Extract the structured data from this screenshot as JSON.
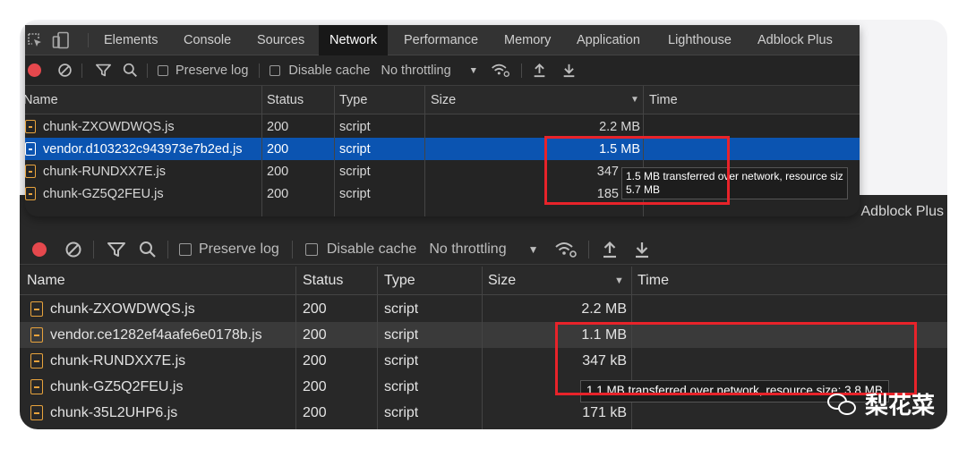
{
  "top_devtools": {
    "tabs": [
      "Elements",
      "Console",
      "Sources",
      "Network",
      "Performance",
      "Memory",
      "Application",
      "Lighthouse",
      "Adblock Plus"
    ],
    "active_tab": "Network",
    "toolbar": {
      "preserve_log": "Preserve log",
      "disable_cache": "Disable cache",
      "throttling": "No throttling"
    },
    "columns": [
      "Name",
      "Status",
      "Type",
      "Size",
      "Time"
    ],
    "rows": [
      {
        "name": "chunk-ZXOWDWQS.js",
        "status": "200",
        "type": "script",
        "size": "2.2 MB"
      },
      {
        "name": "vendor.d103232c943973e7b2ed.js",
        "status": "200",
        "type": "script",
        "size": "1.5 MB"
      },
      {
        "name": "chunk-RUNDXX7E.js",
        "status": "200",
        "type": "script",
        "size": "347"
      },
      {
        "name": "chunk-GZ5Q2FEU.js",
        "status": "200",
        "type": "script",
        "size": "185"
      }
    ],
    "tooltip_line1": "1.5 MB transferred over network, resource siz",
    "tooltip_line2": "5.7 MB"
  },
  "bottom_devtools": {
    "partial_tab": "Adblock Plus",
    "toolbar": {
      "preserve_log": "Preserve log",
      "disable_cache": "Disable cache",
      "throttling": "No throttling"
    },
    "columns": [
      "Name",
      "Status",
      "Type",
      "Size",
      "Time"
    ],
    "rows": [
      {
        "name": "chunk-ZXOWDWQS.js",
        "status": "200",
        "type": "script",
        "size": "2.2 MB"
      },
      {
        "name": "vendor.ce1282ef4aafe6e0178b.js",
        "status": "200",
        "type": "script",
        "size": "1.1 MB"
      },
      {
        "name": "chunk-RUNDXX7E.js",
        "status": "200",
        "type": "script",
        "size": "347 kB"
      },
      {
        "name": "chunk-GZ5Q2FEU.js",
        "status": "200",
        "type": "script",
        "size": "185 kB"
      },
      {
        "name": "chunk-35L2UHP6.js",
        "status": "200",
        "type": "script",
        "size": "171 kB"
      }
    ],
    "tooltip": "1.1 MB transferred over network, resource size: 3.8 MB"
  },
  "watermark": "梨花菜",
  "colors": {
    "highlight_box": "#e8232a",
    "selected_row": "#0b54b1",
    "record": "#e5484d",
    "file_icon": "#e8a33d"
  }
}
